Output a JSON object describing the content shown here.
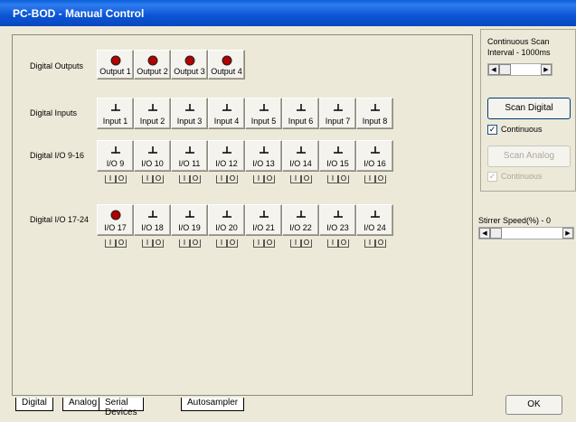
{
  "window": {
    "title": "PC-BOD - Manual Control"
  },
  "rows": {
    "outputs": {
      "label": "Digital Outputs",
      "buttons": [
        "Output 1",
        "Output 2",
        "Output 3",
        "Output 4"
      ]
    },
    "inputs": {
      "label": "Digital Inputs",
      "buttons": [
        "Input 1",
        "Input 2",
        "Input 3",
        "Input 4",
        "Input 5",
        "Input 6",
        "Input 7",
        "Input 8"
      ]
    },
    "io9_16": {
      "label": "Digital I/O 9-16",
      "buttons": [
        "I/O 9",
        "I/O 10",
        "I/O 11",
        "I/O 12",
        "I/O 13",
        "I/O 14",
        "I/O 15",
        "I/O 16"
      ]
    },
    "io17_24": {
      "label": "Digital I/O 17-24",
      "buttons": [
        "I/O 17",
        "I/O 18",
        "I/O 19",
        "I/O 20",
        "I/O 21",
        "I/O 22",
        "I/O 23",
        "I/O 24"
      ]
    }
  },
  "io_toggle": {
    "i": "I",
    "o": "O"
  },
  "icons": {
    "output": "led-icon",
    "input": "ground-switch-icon"
  },
  "right": {
    "scan_label": "Continuous Scan Interval - 1000ms",
    "scan_digital": "Scan Digital",
    "continuous": "Continuous",
    "scan_analog": "Scan Analog",
    "continuous2": "Continuous",
    "stirrer_label": "Stirrer Speed(%) -",
    "stirrer_value": "0",
    "ok": "OK"
  },
  "tabs": [
    "Digital",
    "Analog",
    "Serial Devices",
    "Autosampler"
  ],
  "colors": {
    "title_bar": "#0b54d4",
    "led": "#b00000"
  }
}
